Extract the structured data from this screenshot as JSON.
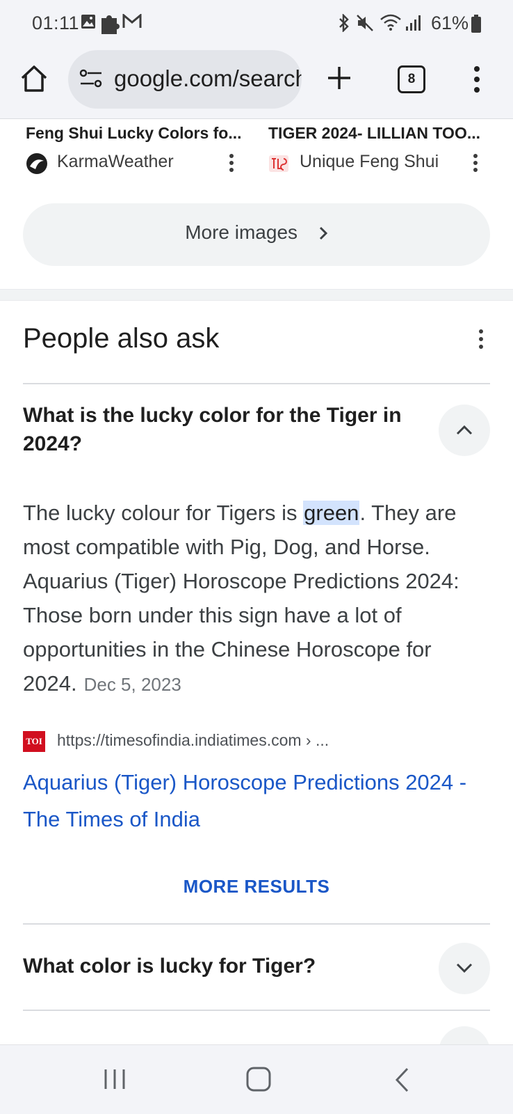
{
  "status_bar": {
    "time": "01:11",
    "battery": "61%",
    "icons": [
      "image-icon",
      "puzzle-icon",
      "gmail-icon",
      "bluetooth-icon",
      "mute-icon",
      "wifi-icon",
      "signal-icon",
      "battery-icon"
    ]
  },
  "toolbar": {
    "url": "google.com/search",
    "tab_count": "8",
    "icons": [
      "home-icon",
      "site-settings-icon",
      "new-tab-icon",
      "tabs-icon",
      "menu-icon"
    ]
  },
  "images": [
    {
      "caption": "Feng Shui Lucky Colors fo...",
      "source": "KarmaWeather"
    },
    {
      "caption": "TIGER 2024- LILLIAN TOO...",
      "source": "Unique Feng Shui"
    }
  ],
  "more_images_label": "More images",
  "people_also_ask": {
    "title": "People also ask",
    "expanded": {
      "question": "What is the lucky color for the Tiger in 2024?",
      "answer_before": "The lucky colour for Tigers is ",
      "answer_highlight": "green",
      "answer_after": ". They are most compatible with Pig, Dog, and Horse. Aquarius (Tiger) Horoscope Predictions 2024: Those born under this sign have a lot of opportunities in the Chinese Horoscope for 2024.",
      "date": "Dec 5, 2023",
      "source_logo": "TOI",
      "source_url": "https://timesofindia.indiatimes.com › ...",
      "link_title": "Aquarius (Tiger) Horoscope Predictions 2024 - The Times of India"
    },
    "more_results_label": "MORE RESULTS",
    "collapsed_question": "What color is lucky for Tiger?"
  },
  "colors": {
    "link": "#1a57c7",
    "highlight": "#d3e3fd",
    "toi_red": "#d10f1f"
  }
}
